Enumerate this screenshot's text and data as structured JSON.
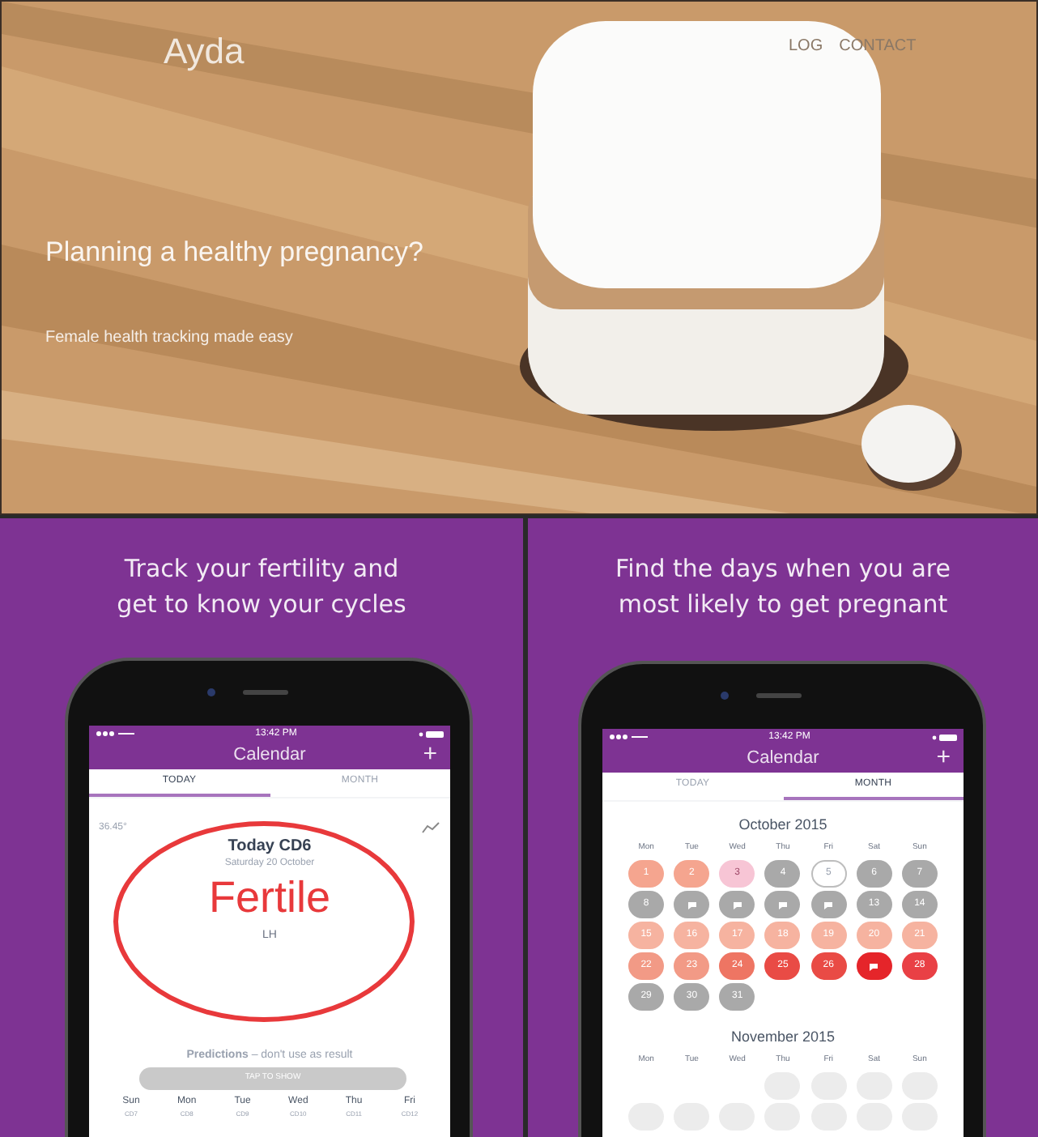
{
  "hero": {
    "logo": "Ayda",
    "nav": [
      "LOG",
      "CONTACT"
    ],
    "headline": "Planning a healthy pregnancy?",
    "subheadline": "Female health tracking made easy"
  },
  "panels": [
    {
      "kind": "today",
      "caption": "Track your fertility and\nget to know your cycles",
      "time": "13:42 PM",
      "title": "Calendar",
      "add": "+",
      "tabs": [
        {
          "label": "TODAY",
          "selected": true
        },
        {
          "label": "MONTH",
          "selected": false
        }
      ],
      "temperature": "36.45°",
      "day_title": "Today CD6",
      "date": "Saturday 20 October",
      "status": "Fertile",
      "marker": "LH",
      "predictions": "**Predictions** – don't use as result",
      "reveal_button": "TAP TO SHOW",
      "week": [
        {
          "day": "Sun",
          "cd": "CD7"
        },
        {
          "day": "Mon",
          "cd": "CD8"
        },
        {
          "day": "Tue",
          "cd": "CD9"
        },
        {
          "day": "Wed",
          "cd": "CD10"
        },
        {
          "day": "Thu",
          "cd": "CD11"
        },
        {
          "day": "Fri",
          "cd": "CD12"
        }
      ]
    },
    {
      "kind": "month",
      "caption": "Find the days when you are\nmost likely to get pregnant",
      "time": "13:42 PM",
      "title": "Calendar",
      "add": "+",
      "tabs": [
        {
          "label": "TODAY",
          "selected": false
        },
        {
          "label": "MONTH",
          "selected": true
        }
      ],
      "months": [
        {
          "title": "October 2015",
          "weekdays": [
            "Mon",
            "Tue",
            "Wed",
            "Thu",
            "Fri",
            "Sat",
            "Sun"
          ],
          "days": [
            {
              "kind": "number",
              "label": "1",
              "color": "#f5a58f"
            },
            {
              "kind": "number",
              "label": "2",
              "color": "#f5a58f"
            },
            {
              "kind": "number",
              "label": "3",
              "color": "#f7c5d5"
            },
            {
              "kind": "number",
              "label": "4",
              "color": "#a9a9a9"
            },
            {
              "kind": "outline",
              "label": "5",
              "color": "#bdbdbd"
            },
            {
              "kind": "number",
              "label": "6",
              "color": "#a9a9a9"
            },
            {
              "kind": "number",
              "label": "7",
              "color": "#a9a9a9"
            },
            {
              "kind": "number",
              "label": "8",
              "color": "#a9a9a9"
            },
            {
              "kind": "icon",
              "color": "#a9a9a9"
            },
            {
              "kind": "icon",
              "color": "#a9a9a9"
            },
            {
              "kind": "icon",
              "color": "#a9a9a9"
            },
            {
              "kind": "icon",
              "color": "#a9a9a9"
            },
            {
              "kind": "number",
              "label": "13",
              "color": "#a9a9a9"
            },
            {
              "kind": "number",
              "label": "14",
              "color": "#a9a9a9"
            },
            {
              "kind": "number",
              "label": "15",
              "color": "#f6b3a0"
            },
            {
              "kind": "number",
              "label": "16",
              "color": "#f6b3a0"
            },
            {
              "kind": "number",
              "label": "17",
              "color": "#f6b3a0"
            },
            {
              "kind": "number",
              "label": "18",
              "color": "#f6b3a0"
            },
            {
              "kind": "number",
              "label": "19",
              "color": "#f6b3a0"
            },
            {
              "kind": "number",
              "label": "20",
              "color": "#f6b3a0"
            },
            {
              "kind": "number",
              "label": "21",
              "color": "#f6b3a0"
            },
            {
              "kind": "number",
              "label": "22",
              "color": "#f29a86"
            },
            {
              "kind": "number",
              "label": "23",
              "color": "#f29a86"
            },
            {
              "kind": "number",
              "label": "24",
              "color": "#ee7563"
            },
            {
              "kind": "number",
              "label": "25",
              "color": "#e94b45"
            },
            {
              "kind": "number",
              "label": "26",
              "color": "#e94b45"
            },
            {
              "kind": "icon",
              "color": "#e5252a"
            },
            {
              "kind": "number",
              "label": "28",
              "color": "#e94045"
            },
            {
              "kind": "number",
              "label": "29",
              "color": "#a9a9a9"
            },
            {
              "kind": "number",
              "label": "30",
              "color": "#a9a9a9"
            },
            {
              "kind": "number",
              "label": "31",
              "color": "#a9a9a9"
            }
          ]
        },
        {
          "title": "November 2015",
          "weekdays": [
            "Mon",
            "Tue",
            "Wed",
            "Thu",
            "Fri",
            "Sat",
            "Sun"
          ],
          "days": [
            {
              "kind": "empty"
            },
            {
              "kind": "empty"
            },
            {
              "kind": "empty"
            },
            {
              "kind": "faint",
              "color": "#ececec"
            },
            {
              "kind": "faint",
              "color": "#ececec"
            },
            {
              "kind": "faint",
              "color": "#ececec"
            },
            {
              "kind": "faint",
              "color": "#ececec"
            },
            {
              "kind": "faint",
              "color": "#ececec"
            },
            {
              "kind": "faint",
              "color": "#ececec"
            },
            {
              "kind": "faint",
              "color": "#ececec"
            },
            {
              "kind": "faint",
              "color": "#ececec"
            },
            {
              "kind": "faint",
              "color": "#ececec"
            },
            {
              "kind": "faint",
              "color": "#ececec"
            },
            {
              "kind": "faint",
              "color": "#ececec"
            }
          ]
        }
      ]
    }
  ]
}
